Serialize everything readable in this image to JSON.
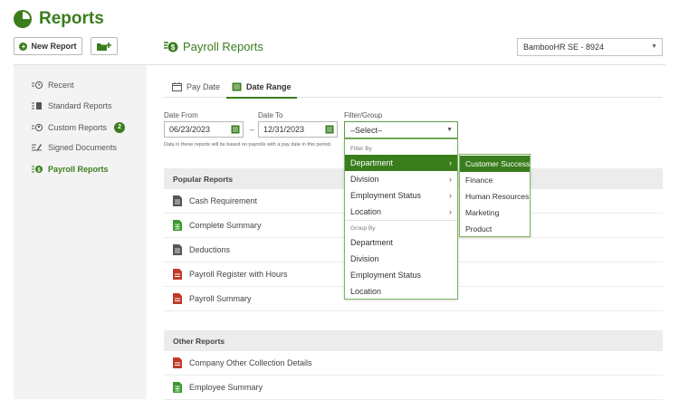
{
  "app": {
    "title": "Reports"
  },
  "toolbar": {
    "new_report_label": "New Report"
  },
  "page": {
    "title": "Payroll Reports"
  },
  "company_select": {
    "value": "BambooHR SE - 8924"
  },
  "sidebar": {
    "items": [
      {
        "label": "Recent",
        "icon": "recent-icon"
      },
      {
        "label": "Standard Reports",
        "icon": "standard-reports-icon"
      },
      {
        "label": "Custom Reports",
        "icon": "custom-reports-icon",
        "badge": "2"
      },
      {
        "label": "Signed Documents",
        "icon": "signed-documents-icon"
      },
      {
        "label": "Payroll Reports",
        "icon": "payroll-reports-icon",
        "active": true
      }
    ]
  },
  "tabs": [
    {
      "label": "Pay Date",
      "icon": "calendar-icon"
    },
    {
      "label": "Date Range",
      "icon": "calendar-range-icon",
      "active": true
    }
  ],
  "form": {
    "date_from_label": "Date From",
    "date_from_value": "06/23/2023",
    "date_to_label": "Date To",
    "date_to_value": "12/31/2023",
    "separator": "–",
    "filter_label": "Filter/Group",
    "filter_value": "–Select–",
    "hint": "Data in these reports will be based on payrolls with a pay date in this period."
  },
  "dropdown": {
    "filter_by_label": "Filter By",
    "filter_by": [
      "Department",
      "Division",
      "Employment Status",
      "Location"
    ],
    "group_by_label": "Group By",
    "group_by": [
      "Department",
      "Division",
      "Employment Status",
      "Location"
    ],
    "highlighted": "Department"
  },
  "submenu": {
    "items": [
      "Customer Success",
      "Finance",
      "Human Resources",
      "Marketing",
      "Product"
    ],
    "highlighted": "Customer Success"
  },
  "popular": {
    "title": "Popular Reports",
    "items": [
      {
        "label": "Cash Requirement",
        "icon": "document-gray-icon"
      },
      {
        "label": "Complete Summary",
        "icon": "spreadsheet-green-icon"
      },
      {
        "label": "Deductions",
        "icon": "document-gray-icon"
      },
      {
        "label": "Payroll Register with Hours",
        "icon": "pdf-red-icon"
      },
      {
        "label": "Payroll Summary",
        "icon": "pdf-red-icon"
      }
    ]
  },
  "other": {
    "title": "Other Reports",
    "items": [
      {
        "label": "Company Other Collection Details",
        "icon": "pdf-red-icon"
      },
      {
        "label": "Employee Summary",
        "icon": "spreadsheet-green-icon"
      }
    ]
  },
  "colors": {
    "accent": "#3a7d1d",
    "sidebar_bg": "#f3f3f3",
    "section_bg": "#ececec",
    "pdf": "#c0392b"
  }
}
